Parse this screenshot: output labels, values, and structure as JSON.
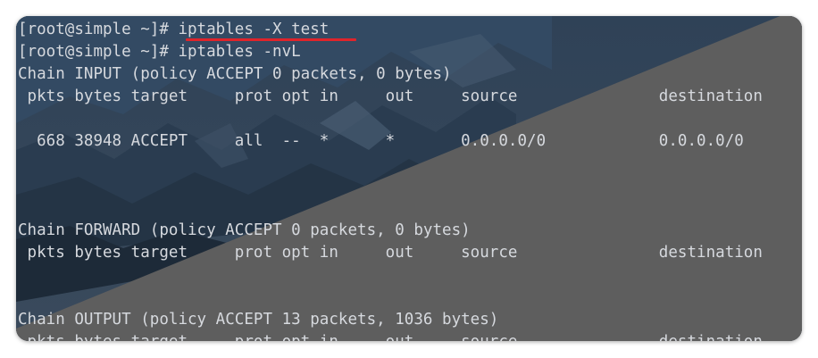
{
  "terminal": {
    "lines": [
      "[root@simple ~]# iptables -X test",
      "[root@simple ~]# iptables -nvL",
      "Chain INPUT (policy ACCEPT 0 packets, 0 bytes)",
      " pkts bytes target     prot opt in     out     source               destination",
      "",
      "  668 38948 ACCEPT     all  --  *      *       0.0.0.0/0            0.0.0.0/0",
      "",
      "",
      "",
      "Chain FORWARD (policy ACCEPT 0 packets, 0 bytes)",
      " pkts bytes target     prot opt in     out     source               destination",
      "",
      "",
      "Chain OUTPUT (policy ACCEPT 13 packets, 1036 bytes)",
      " pkts bytes target     prot opt in     out     source               destination"
    ]
  },
  "colors": {
    "text": "#d6d9de",
    "highlight_underline": "#e0242b",
    "overlay_gray": "#5e5e5e"
  }
}
